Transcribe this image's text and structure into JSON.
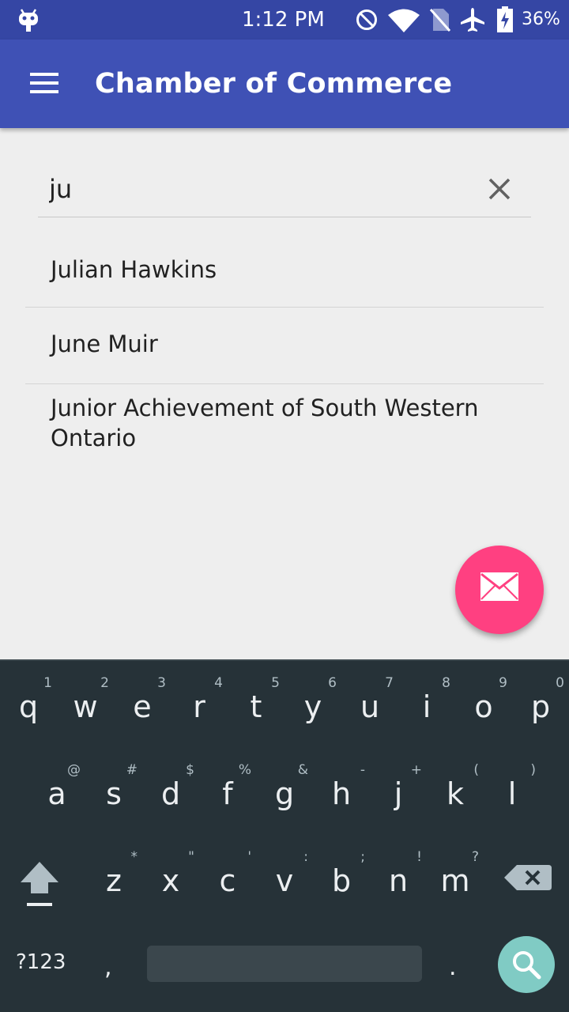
{
  "status_bar": {
    "time": "1:12 PM",
    "battery": "36%",
    "icons": [
      "android-robot-icon",
      "do-not-disturb-icon",
      "wifi-icon",
      "no-sim-icon",
      "airplane-icon",
      "battery-charging-icon"
    ]
  },
  "app_bar": {
    "title": "Chamber of Commerce",
    "menu_icon": "hamburger-menu-icon"
  },
  "search": {
    "value": "ju",
    "clear_icon": "close-icon"
  },
  "results": [
    {
      "label": "Julian Hawkins"
    },
    {
      "label": "June Muir"
    },
    {
      "label": "Junior Achievement of South Western Ontario"
    }
  ],
  "fab": {
    "icon": "envelope-icon",
    "color": "#ff4081"
  },
  "keyboard": {
    "row1": [
      {
        "key": "q",
        "hint": "1"
      },
      {
        "key": "w",
        "hint": "2"
      },
      {
        "key": "e",
        "hint": "3"
      },
      {
        "key": "r",
        "hint": "4"
      },
      {
        "key": "t",
        "hint": "5"
      },
      {
        "key": "y",
        "hint": "6"
      },
      {
        "key": "u",
        "hint": "7"
      },
      {
        "key": "i",
        "hint": "8"
      },
      {
        "key": "o",
        "hint": "9"
      },
      {
        "key": "p",
        "hint": "0"
      }
    ],
    "row2": [
      {
        "key": "a",
        "hint": "@"
      },
      {
        "key": "s",
        "hint": "#"
      },
      {
        "key": "d",
        "hint": "$"
      },
      {
        "key": "f",
        "hint": "%"
      },
      {
        "key": "g",
        "hint": "&"
      },
      {
        "key": "h",
        "hint": "-"
      },
      {
        "key": "j",
        "hint": "+"
      },
      {
        "key": "k",
        "hint": "("
      },
      {
        "key": "l",
        "hint": ")"
      }
    ],
    "row3": [
      {
        "key": "z",
        "hint": "*"
      },
      {
        "key": "x",
        "hint": "\""
      },
      {
        "key": "c",
        "hint": "'"
      },
      {
        "key": "v",
        "hint": ":"
      },
      {
        "key": "b",
        "hint": ";"
      },
      {
        "key": "n",
        "hint": "!"
      },
      {
        "key": "m",
        "hint": "?"
      }
    ],
    "symbols_label": "?123",
    "comma": ",",
    "period": ".",
    "accent_color": "#80cbc4"
  },
  "colors": {
    "primary": "#3f51b5",
    "primary_dark": "#3546a4",
    "accent": "#ff4081",
    "keyboard_bg": "#263238"
  }
}
